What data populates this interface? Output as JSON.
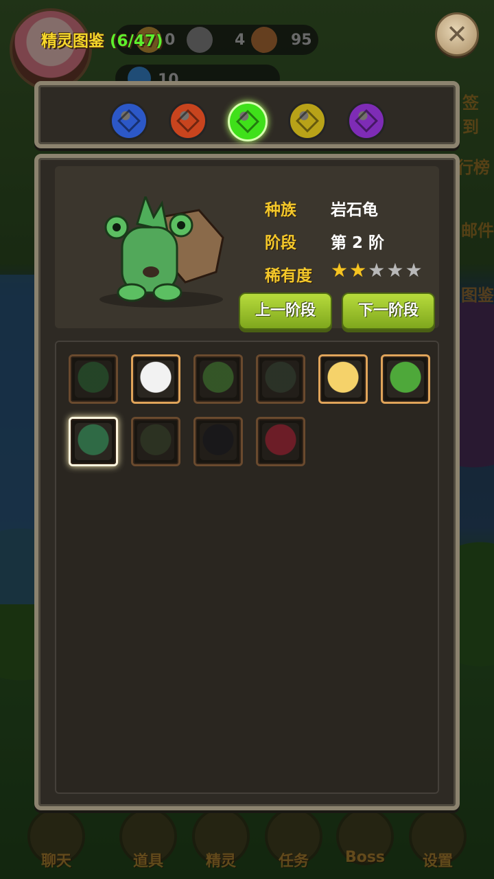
{
  "title": {
    "text": "精灵图鉴",
    "count": "(6/47)"
  },
  "hud": {
    "value1": "0",
    "value2": "4",
    "value3": "95",
    "value4": "10"
  },
  "side_labels": [
    "签到",
    "行榜",
    "邮件",
    "图鉴"
  ],
  "element_tabs": [
    {
      "name": "water",
      "color": "#2c58c8"
    },
    {
      "name": "fire",
      "color": "#c8441e"
    },
    {
      "name": "wood",
      "color": "#3fe01a",
      "active": true
    },
    {
      "name": "earth",
      "color": "#b8a218"
    },
    {
      "name": "dark",
      "color": "#7e2cb6"
    }
  ],
  "info": {
    "species_label": "种族",
    "species_value": "岩石龟",
    "stage_label": "阶段",
    "stage_value": "第 2 阶",
    "rarity_label": "稀有度",
    "rarity_stars": 2,
    "rarity_max": 5,
    "prev_stage_button": "上一阶段",
    "next_stage_button": "下一阶段"
  },
  "sprites": [
    {
      "name": "green-fox",
      "owned": false,
      "color": "#2f6a3a"
    },
    {
      "name": "panda",
      "owned": true,
      "color": "#f2f2f2"
    },
    {
      "name": "green-goblin",
      "owned": false,
      "color": "#4a8a3a"
    },
    {
      "name": "stone-snail",
      "owned": false,
      "color": "#3a4a3a"
    },
    {
      "name": "flower-girl",
      "owned": true,
      "color": "#f5d26a"
    },
    {
      "name": "green-block",
      "owned": true,
      "color": "#4ea83a"
    },
    {
      "name": "rock-turtle",
      "owned": false,
      "color": "#2f6a45",
      "selected": true
    },
    {
      "name": "bramble",
      "owned": false,
      "color": "#3d4a30"
    },
    {
      "name": "black-bird",
      "owned": false,
      "color": "#1a1a22"
    },
    {
      "name": "red-blob",
      "owned": false,
      "color": "#b0243a"
    }
  ],
  "nav": [
    "聊天",
    "道具",
    "精灵",
    "任务",
    "Boss",
    "设置"
  ]
}
